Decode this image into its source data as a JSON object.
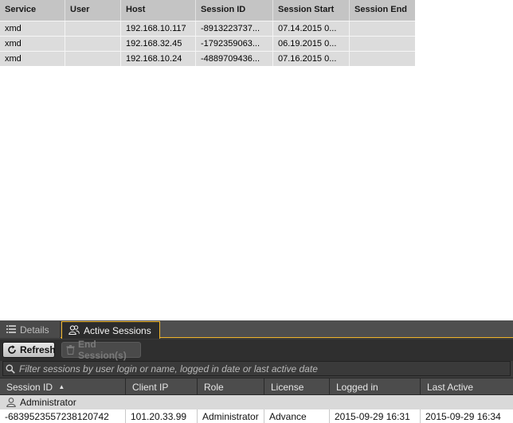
{
  "top_table": {
    "columns": [
      "Service",
      "User",
      "Host",
      "Session ID",
      "Session Start",
      "Session End"
    ],
    "rows": [
      [
        "xmd",
        "",
        "192.168.10.117",
        "-8913223737...",
        "07.14.2015 0...",
        ""
      ],
      [
        "xmd",
        "",
        "192.168.32.45",
        "-1792359063...",
        "06.19.2015 0...",
        ""
      ],
      [
        "xmd",
        "",
        "192.168.10.24",
        "-4889709436...",
        "07.16.2015 0...",
        ""
      ]
    ]
  },
  "panel": {
    "tabs": [
      {
        "label": "Details",
        "icon": "list-icon"
      },
      {
        "label": "Active Sessions",
        "icon": "users-icon"
      }
    ],
    "toolbar": {
      "refresh_label": "Refresh",
      "end_session_label": "End Session(s)"
    },
    "search": {
      "placeholder": "Filter sessions by user login or name, logged in date or last active date",
      "value": ""
    },
    "grid": {
      "columns": [
        "Session ID",
        "Client IP",
        "Role",
        "License",
        "Logged in",
        "Last Active"
      ],
      "sort_indicator": "▲",
      "group_label": "Administrator",
      "rows": [
        [
          "-6839523557238120742",
          "101.20.33.99",
          "Administrator",
          "Advance",
          "2015-09-29 16:31",
          "2015-09-29 16:34"
        ]
      ]
    }
  },
  "colors": {
    "accent": "#f0b429",
    "panel_bg": "#3b3b3b",
    "table_header_bg": "#c4c4c4",
    "table_row_bg": "#dcdcdc"
  }
}
